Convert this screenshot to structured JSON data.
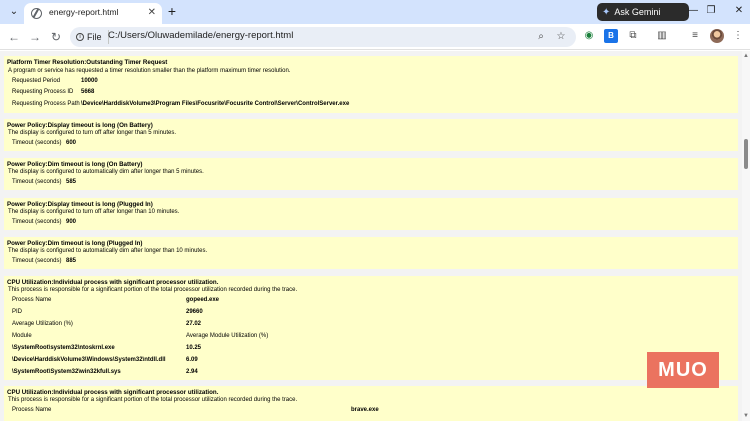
{
  "browser": {
    "tab_title": "energy-report.html",
    "gemini_label": "Ask Gemini",
    "file_chip": "File",
    "url": "C:/Users/Oluwademilade/energy-report.html"
  },
  "sections": [
    {
      "title": "Platform Timer Resolution:Outstanding Timer Request",
      "desc": "A program or service has requested a timer resolution smaller than the platform maximum timer resolution.",
      "rows": [
        {
          "label": "Requested Period",
          "value": "10000"
        },
        {
          "label": "Requesting Process ID",
          "value": "5668"
        },
        {
          "label": "Requesting Process Path",
          "value": "\\Device\\HarddiskVolume3\\Program Files\\Focusrite\\Focusrite Control\\Server\\ControlServer.exe"
        }
      ]
    },
    {
      "title": "Power Policy:Display timeout is long (On Battery)",
      "desc": "The display is configured to turn off after longer than 5 minutes.",
      "rows": [
        {
          "label": "Timeout (seconds)",
          "value": "600"
        }
      ]
    },
    {
      "title": "Power Policy:Dim timeout is long (On Battery)",
      "desc": "The display is configured to automatically dim after longer than 5 minutes.",
      "rows": [
        {
          "label": "Timeout (seconds)",
          "value": "585"
        }
      ]
    },
    {
      "title": "Power Policy:Display timeout is long (Plugged In)",
      "desc": "The display is configured to turn off after longer than 10 minutes.",
      "rows": [
        {
          "label": "Timeout (seconds)",
          "value": "900"
        }
      ]
    },
    {
      "title": "Power Policy:Dim timeout is long (Plugged In)",
      "desc": "The display is configured to automatically dim after longer than 10 minutes.",
      "rows": [
        {
          "label": "Timeout (seconds)",
          "value": "885"
        }
      ]
    },
    {
      "title": "CPU Utilization:Individual process with significant processor utilization.",
      "desc": "This process is responsible for a significant portion of the total processor utilization recorded during the trace.",
      "rows": [
        {
          "label": "Process Name",
          "value": "gopeed.exe"
        },
        {
          "label": "PID",
          "value": "29660"
        },
        {
          "label": "Average Utilization (%)",
          "value": "27.02"
        },
        {
          "label": "Module",
          "value": "Average Module Utilization (%)"
        },
        {
          "label": "\\SystemRoot\\system32\\ntoskrnl.exe",
          "value": "10.25"
        },
        {
          "label": "\\Device\\HarddiskVolume3\\Windows\\System32\\ntdll.dll",
          "value": "6.09"
        },
        {
          "label": "\\SystemRoot\\System32\\win32kfull.sys",
          "value": "2.94"
        }
      ]
    },
    {
      "title": "CPU Utilization:Individual process with significant processor utilization.",
      "desc": "This process is responsible for a significant portion of the total processor utilization recorded during the trace.",
      "rows": [
        {
          "label": "Process Name",
          "value": "brave.exe"
        }
      ]
    }
  ],
  "watermark": "MUO"
}
